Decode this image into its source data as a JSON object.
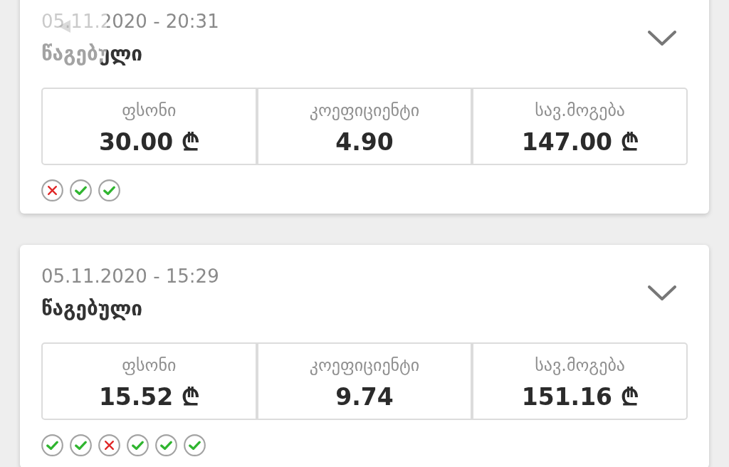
{
  "bets": [
    {
      "datetime": "05.11.2020 - 20:31",
      "status": "წაგებული",
      "expanded": false,
      "stats": [
        {
          "label": "ფსონი",
          "value": "30.00 ₾"
        },
        {
          "label": "კოეფიციენტი",
          "value": "4.90"
        },
        {
          "label": "სავ.მოგება",
          "value": "147.00 ₾"
        }
      ],
      "selections": [
        {
          "kind": "loss"
        },
        {
          "kind": "win"
        },
        {
          "kind": "win"
        }
      ]
    },
    {
      "datetime": "05.11.2020 - 15:29",
      "status": "წაგებული",
      "expanded": false,
      "stats": [
        {
          "label": "ფსონი",
          "value": "15.52 ₾"
        },
        {
          "label": "კოეფიციენტი",
          "value": "9.74"
        },
        {
          "label": "სავ.მოგება",
          "value": "151.16 ₾"
        }
      ],
      "selections": [
        {
          "kind": "win"
        },
        {
          "kind": "win"
        },
        {
          "kind": "loss"
        },
        {
          "kind": "win"
        },
        {
          "kind": "win"
        },
        {
          "kind": "win"
        }
      ]
    }
  ]
}
